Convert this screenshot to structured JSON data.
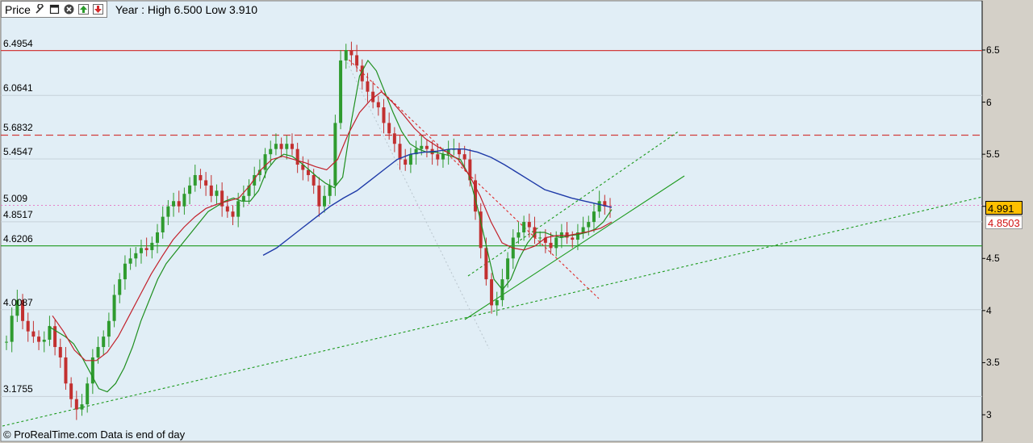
{
  "toolbar": {
    "price_label": "Price",
    "range_text": "Year : High 6.500 Low 3.910",
    "icons": [
      "wrench-icon",
      "window-icon",
      "close-icon",
      "move-up-icon",
      "move-down-icon"
    ]
  },
  "footer": {
    "text": "© ProRealTime.com Data is end of day"
  },
  "chart_data": {
    "type": "candlestick",
    "ylim": [
      2.9,
      6.8
    ],
    "y_ticks": [
      "6.5",
      "6",
      "5.5",
      "5",
      "4.5",
      "4",
      "3.5",
      "3"
    ],
    "grid": true,
    "price_levels": [
      {
        "label": "6.4954",
        "value": 6.4954,
        "style": "solid",
        "color": "#d23c3c"
      },
      {
        "label": "6.0641",
        "value": 6.0641,
        "style": "grid"
      },
      {
        "label": "5.6832",
        "value": 5.6832,
        "style": "dashed",
        "color": "#d23c3c"
      },
      {
        "label": "5.4547",
        "value": 5.4547,
        "style": "grid"
      },
      {
        "label": "5.009",
        "value": 5.009,
        "style": "dotted",
        "color": "#e67fc7"
      },
      {
        "label": "4.8517",
        "value": 4.8517,
        "style": "grid"
      },
      {
        "label": "4.6206",
        "value": 4.6206,
        "style": "solid",
        "color": "#1c9a1c"
      },
      {
        "label": "4.0087",
        "value": 4.0087,
        "style": "grid"
      },
      {
        "label": "3.1755",
        "value": 3.1755,
        "style": "grid"
      }
    ],
    "last_values": [
      {
        "label": "4.991",
        "value": 4.991,
        "bg": "#ffc000",
        "fg": "#000000"
      },
      {
        "label": "4.8503",
        "value": 4.8503,
        "bg": "#ffffff",
        "fg": "#d01010"
      }
    ],
    "close": [
      3.7,
      3.95,
      4.1,
      3.9,
      3.8,
      3.75,
      3.7,
      3.72,
      3.85,
      3.65,
      3.55,
      3.3,
      3.15,
      3.05,
      3.1,
      3.3,
      3.55,
      3.65,
      3.75,
      3.9,
      4.15,
      4.3,
      4.45,
      4.5,
      4.55,
      4.6,
      4.58,
      4.65,
      4.75,
      4.9,
      5.0,
      5.05,
      5.0,
      5.12,
      5.2,
      5.3,
      5.25,
      5.2,
      5.1,
      5.15,
      5.0,
      4.95,
      4.9,
      5.05,
      5.1,
      5.2,
      5.3,
      5.35,
      5.5,
      5.55,
      5.6,
      5.55,
      5.6,
      5.55,
      5.4,
      5.35,
      5.3,
      5.2,
      5.0,
      5.1,
      5.2,
      5.8,
      6.4,
      6.5,
      6.45,
      6.35,
      6.2,
      6.1,
      6.0,
      5.95,
      5.8,
      5.7,
      5.6,
      5.45,
      5.4,
      5.5,
      5.55,
      5.58,
      5.55,
      5.5,
      5.45,
      5.5,
      5.55,
      5.55,
      5.5,
      5.45,
      5.25,
      4.95,
      4.6,
      4.3,
      4.05,
      4.1,
      4.3,
      4.5,
      4.7,
      4.75,
      4.85,
      4.8,
      4.7,
      4.7,
      4.65,
      4.6,
      4.7,
      4.75,
      4.7,
      4.68,
      4.75,
      4.8,
      4.85,
      4.95,
      5.05,
      5.0,
      4.99
    ],
    "ma_short": [
      3.85,
      3.8,
      3.75,
      3.68,
      3.55,
      3.4,
      3.25,
      3.22,
      3.3,
      3.45,
      3.65,
      3.9,
      4.1,
      4.3,
      4.45,
      4.55,
      4.65,
      4.75,
      4.85,
      4.95,
      5.0,
      5.05,
      5.08,
      5.05,
      5.05,
      5.15,
      5.35,
      5.45,
      5.5,
      5.48,
      5.42,
      5.35,
      5.28,
      5.22,
      5.18,
      5.28,
      5.8,
      6.25,
      6.4,
      6.3,
      6.1,
      5.9,
      5.72,
      5.6,
      5.55,
      5.52,
      5.52,
      5.5,
      5.48,
      5.45,
      5.3,
      5.0,
      4.65,
      4.3,
      4.2,
      4.3,
      4.5,
      4.65,
      4.75,
      4.75,
      4.72,
      4.7,
      4.72,
      4.73,
      4.75,
      4.78,
      4.85,
      4.97
    ],
    "ma_medium": [
      3.95,
      3.8,
      3.62,
      3.52,
      3.52,
      3.6,
      3.75,
      3.95,
      4.15,
      4.35,
      4.52,
      4.68,
      4.8,
      4.9,
      4.98,
      5.02,
      5.05,
      5.08,
      5.2,
      5.35,
      5.45,
      5.48,
      5.45,
      5.42,
      5.38,
      5.35,
      5.45,
      5.7,
      5.9,
      6.02,
      6.1,
      6.0,
      5.88,
      5.75,
      5.65,
      5.58,
      5.52,
      5.45,
      5.3,
      5.1,
      4.85,
      4.65,
      4.6,
      4.58,
      4.62,
      4.7,
      4.72,
      4.72,
      4.74,
      4.76,
      4.79,
      4.85
    ],
    "ma_long": [
      4.53,
      4.6,
      4.7,
      4.8,
      4.9,
      5.0,
      5.08,
      5.15,
      5.25,
      5.35,
      5.45,
      5.5,
      5.52,
      5.53,
      5.55,
      5.55,
      5.52,
      5.47,
      5.4,
      5.32,
      5.24,
      5.16,
      5.12,
      5.08,
      5.05,
      5.02,
      4.99
    ]
  }
}
